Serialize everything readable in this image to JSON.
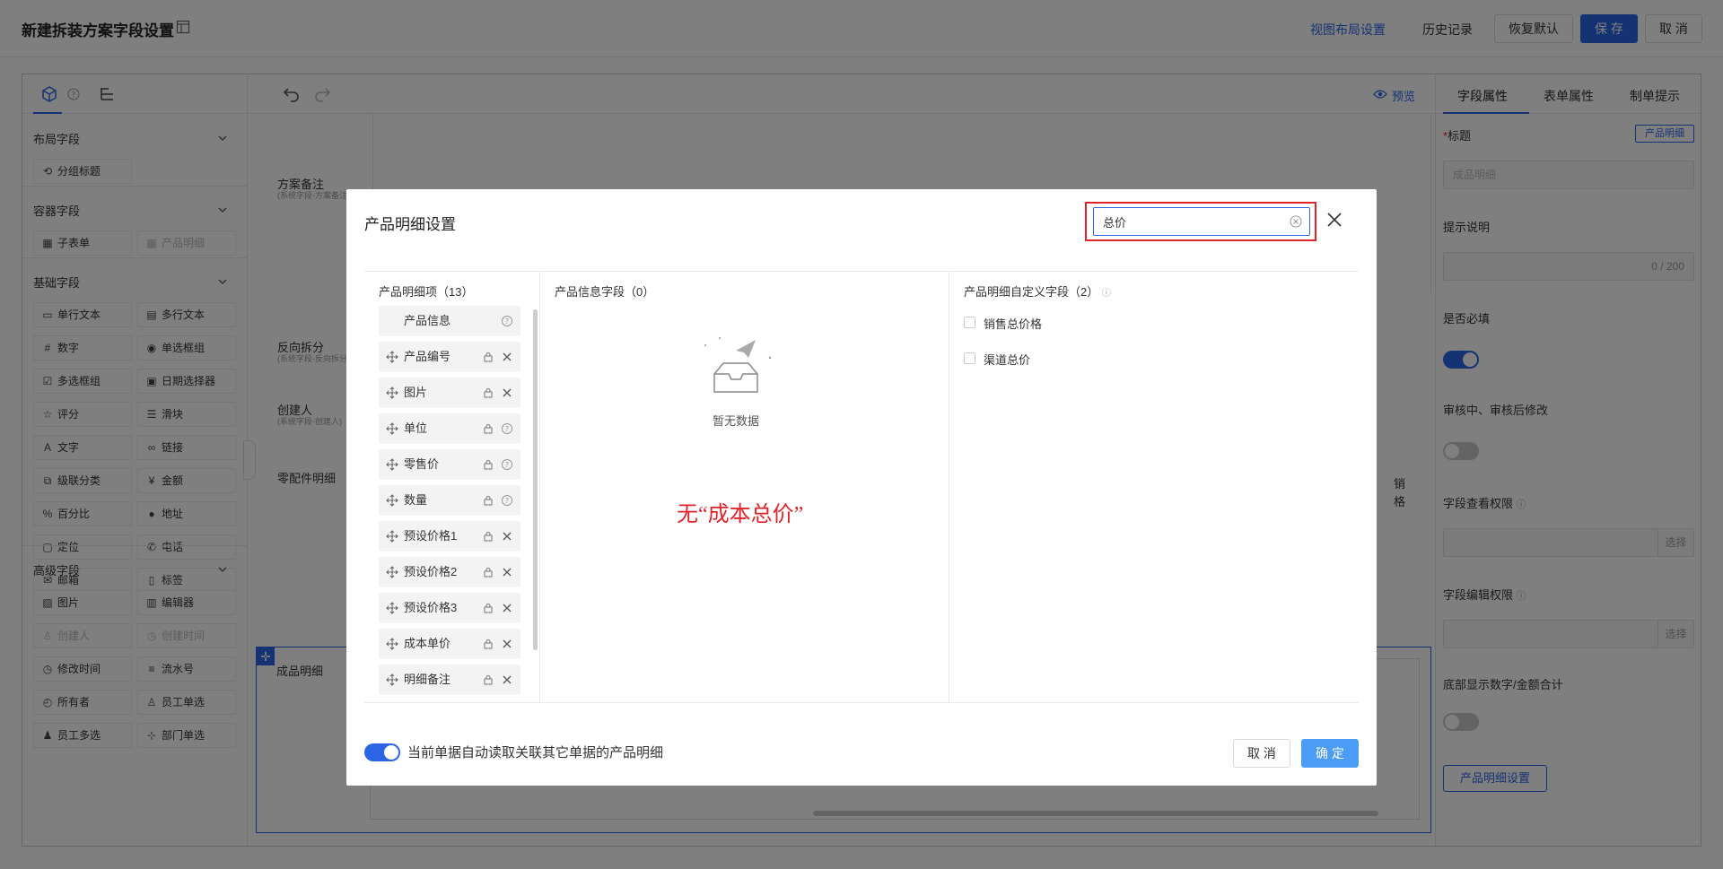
{
  "header": {
    "title": "新建拆装方案字段设置",
    "view_layout": "视图布局设置",
    "history": "历史记录",
    "restore": "恢复默认",
    "save": "保 存",
    "cancel": "取 消"
  },
  "left_panel": {
    "sections": [
      {
        "title": "布局字段",
        "items": [
          {
            "label": "分组标题",
            "icon": "split-icon",
            "disabled": false
          }
        ]
      },
      {
        "title": "容器字段",
        "items": [
          {
            "label": "子表单",
            "icon": "table-icon",
            "disabled": false
          },
          {
            "label": "产品明细",
            "icon": "table-icon",
            "disabled": true
          }
        ]
      },
      {
        "title": "基础字段",
        "items": [
          {
            "label": "单行文本",
            "icon": "single-line-icon",
            "disabled": false
          },
          {
            "label": "多行文本",
            "icon": "multi-line-icon",
            "disabled": false
          },
          {
            "label": "数字",
            "icon": "number-icon",
            "disabled": false
          },
          {
            "label": "单选框组",
            "icon": "radio-icon",
            "disabled": false
          },
          {
            "label": "多选框组",
            "icon": "checkbox-icon",
            "disabled": false
          },
          {
            "label": "日期选择器",
            "icon": "calendar-icon",
            "disabled": false
          },
          {
            "label": "评分",
            "icon": "star-icon",
            "disabled": false
          },
          {
            "label": "滑块",
            "icon": "slider-icon",
            "disabled": false
          },
          {
            "label": "文字",
            "icon": "text-icon",
            "disabled": false
          },
          {
            "label": "链接",
            "icon": "link-icon",
            "disabled": false
          },
          {
            "label": "级联分类",
            "icon": "cascade-icon",
            "disabled": false
          },
          {
            "label": "金额",
            "icon": "money-icon",
            "disabled": false
          },
          {
            "label": "百分比",
            "icon": "percent-icon",
            "disabled": false
          },
          {
            "label": "地址",
            "icon": "location-pin-icon",
            "disabled": false
          },
          {
            "label": "定位",
            "icon": "locate-icon",
            "disabled": false
          },
          {
            "label": "电话",
            "icon": "phone-icon",
            "disabled": false
          },
          {
            "label": "邮箱",
            "icon": "mail-icon",
            "disabled": false
          },
          {
            "label": "标签",
            "icon": "tag-icon",
            "disabled": false
          }
        ]
      },
      {
        "title": "高级字段",
        "items": [
          {
            "label": "图片",
            "icon": "image-icon",
            "disabled": false
          },
          {
            "label": "编辑器",
            "icon": "editor-icon",
            "disabled": false
          },
          {
            "label": "创建人",
            "icon": "user-icon",
            "disabled": true
          },
          {
            "label": "创建时间",
            "icon": "clock-icon",
            "disabled": true
          },
          {
            "label": "修改时间",
            "icon": "clock-icon",
            "disabled": false
          },
          {
            "label": "流水号",
            "icon": "list-number-icon",
            "disabled": false
          },
          {
            "label": "所有者",
            "icon": "owner-icon",
            "disabled": false
          },
          {
            "label": "员工单选",
            "icon": "user-icon",
            "disabled": false
          },
          {
            "label": "员工多选",
            "icon": "users-icon",
            "disabled": false
          },
          {
            "label": "部门单选",
            "icon": "department-icon",
            "disabled": false
          }
        ]
      }
    ]
  },
  "canvas": {
    "preview": "预览",
    "labels": {
      "plan_note": "方案备注",
      "plan_note_sub": "(系统字段-方案备注)",
      "reverse": "反向拆分",
      "reverse_sub": "(系统字段-反向拆分)",
      "creator": "创建人",
      "creator_sub": "(系统字段-创建人)",
      "parts_detail": "零配件明细",
      "product_detail": "成品明细",
      "col_a": "销",
      "col_b": "格"
    }
  },
  "right_panel": {
    "tabs": [
      "字段属性",
      "表单属性",
      "制单提示"
    ],
    "title_label": "标题",
    "title_badge": "产品明细",
    "title_value": "成品明细",
    "hint_label": "提示说明",
    "hint_counter": "0 / 200",
    "required_label": "是否必填",
    "audit_label": "审核中、审核后修改",
    "view_perm_label": "字段查看权限",
    "edit_perm_label": "字段编辑权限",
    "select": "选择",
    "sum_label": "底部显示数字/金额合计",
    "detail_btn": "产品明细设置"
  },
  "modal": {
    "title": "产品明细设置",
    "search_value": "总价",
    "col1_head": "产品明细项（13）",
    "col1_items": [
      {
        "label": "产品信息",
        "draggable": false,
        "locked": false,
        "action": "help"
      },
      {
        "label": "产品编号",
        "draggable": true,
        "locked": true,
        "action": "close"
      },
      {
        "label": "图片",
        "draggable": true,
        "locked": true,
        "action": "close"
      },
      {
        "label": "单位",
        "draggable": true,
        "locked": true,
        "action": "help"
      },
      {
        "label": "零售价",
        "draggable": true,
        "locked": true,
        "action": "help"
      },
      {
        "label": "数量",
        "draggable": true,
        "locked": true,
        "action": "help"
      },
      {
        "label": "预设价格1",
        "draggable": true,
        "locked": true,
        "action": "close"
      },
      {
        "label": "预设价格2",
        "draggable": true,
        "locked": true,
        "action": "close"
      },
      {
        "label": "预设价格3",
        "draggable": true,
        "locked": true,
        "action": "close"
      },
      {
        "label": "成本单价",
        "draggable": true,
        "locked": true,
        "action": "close"
      },
      {
        "label": "明细备注",
        "draggable": true,
        "locked": true,
        "action": "close"
      }
    ],
    "col2_head": "产品信息字段（0）",
    "empty_text": "暂无数据",
    "annotation": "无“成本总价”",
    "col3_head": "产品明细自定义字段（2）",
    "col3_items": [
      "销售总价格",
      "渠道总价"
    ],
    "footer_text": "当前单据自动读取关联其它单据的产品明细",
    "cancel": "取 消",
    "confirm": "确 定"
  },
  "colors": {
    "primary": "#2b65e6",
    "highlight": "#e0252a"
  }
}
